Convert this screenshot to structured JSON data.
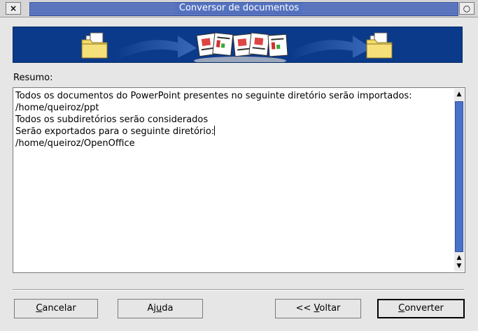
{
  "window": {
    "title": "Conversor de documentos",
    "close_label": "×",
    "maximize_label": "○"
  },
  "summary": {
    "label": "Resumo:",
    "lines": [
      "Todos os documentos do PowerPoint presentes no seguinte diretório serão importados:",
      "/home/queiroz/ppt",
      "Todos os subdiretórios serão considerados",
      "Serão exportados para o seguinte diretório:",
      "/home/queiroz/OpenOffice"
    ]
  },
  "buttons": {
    "cancel": {
      "pre": "",
      "mnemonic": "C",
      "post": "ancelar"
    },
    "help": {
      "pre": "Aj",
      "mnemonic": "u",
      "post": "da"
    },
    "back": {
      "pre": "<< ",
      "mnemonic": "V",
      "post": "oltar"
    },
    "convert": {
      "pre": "",
      "mnemonic": "C",
      "post": "onverter"
    }
  },
  "icons": {
    "source_folder": "folder-icon",
    "documents": "document-stack-icon",
    "target_folder": "folder-icon",
    "arrow": "arrow-right-icon"
  },
  "colors": {
    "banner_bg": "#0b3a8a",
    "title_bar": "#5472bf",
    "scroll_thumb": "#4a70c8"
  }
}
